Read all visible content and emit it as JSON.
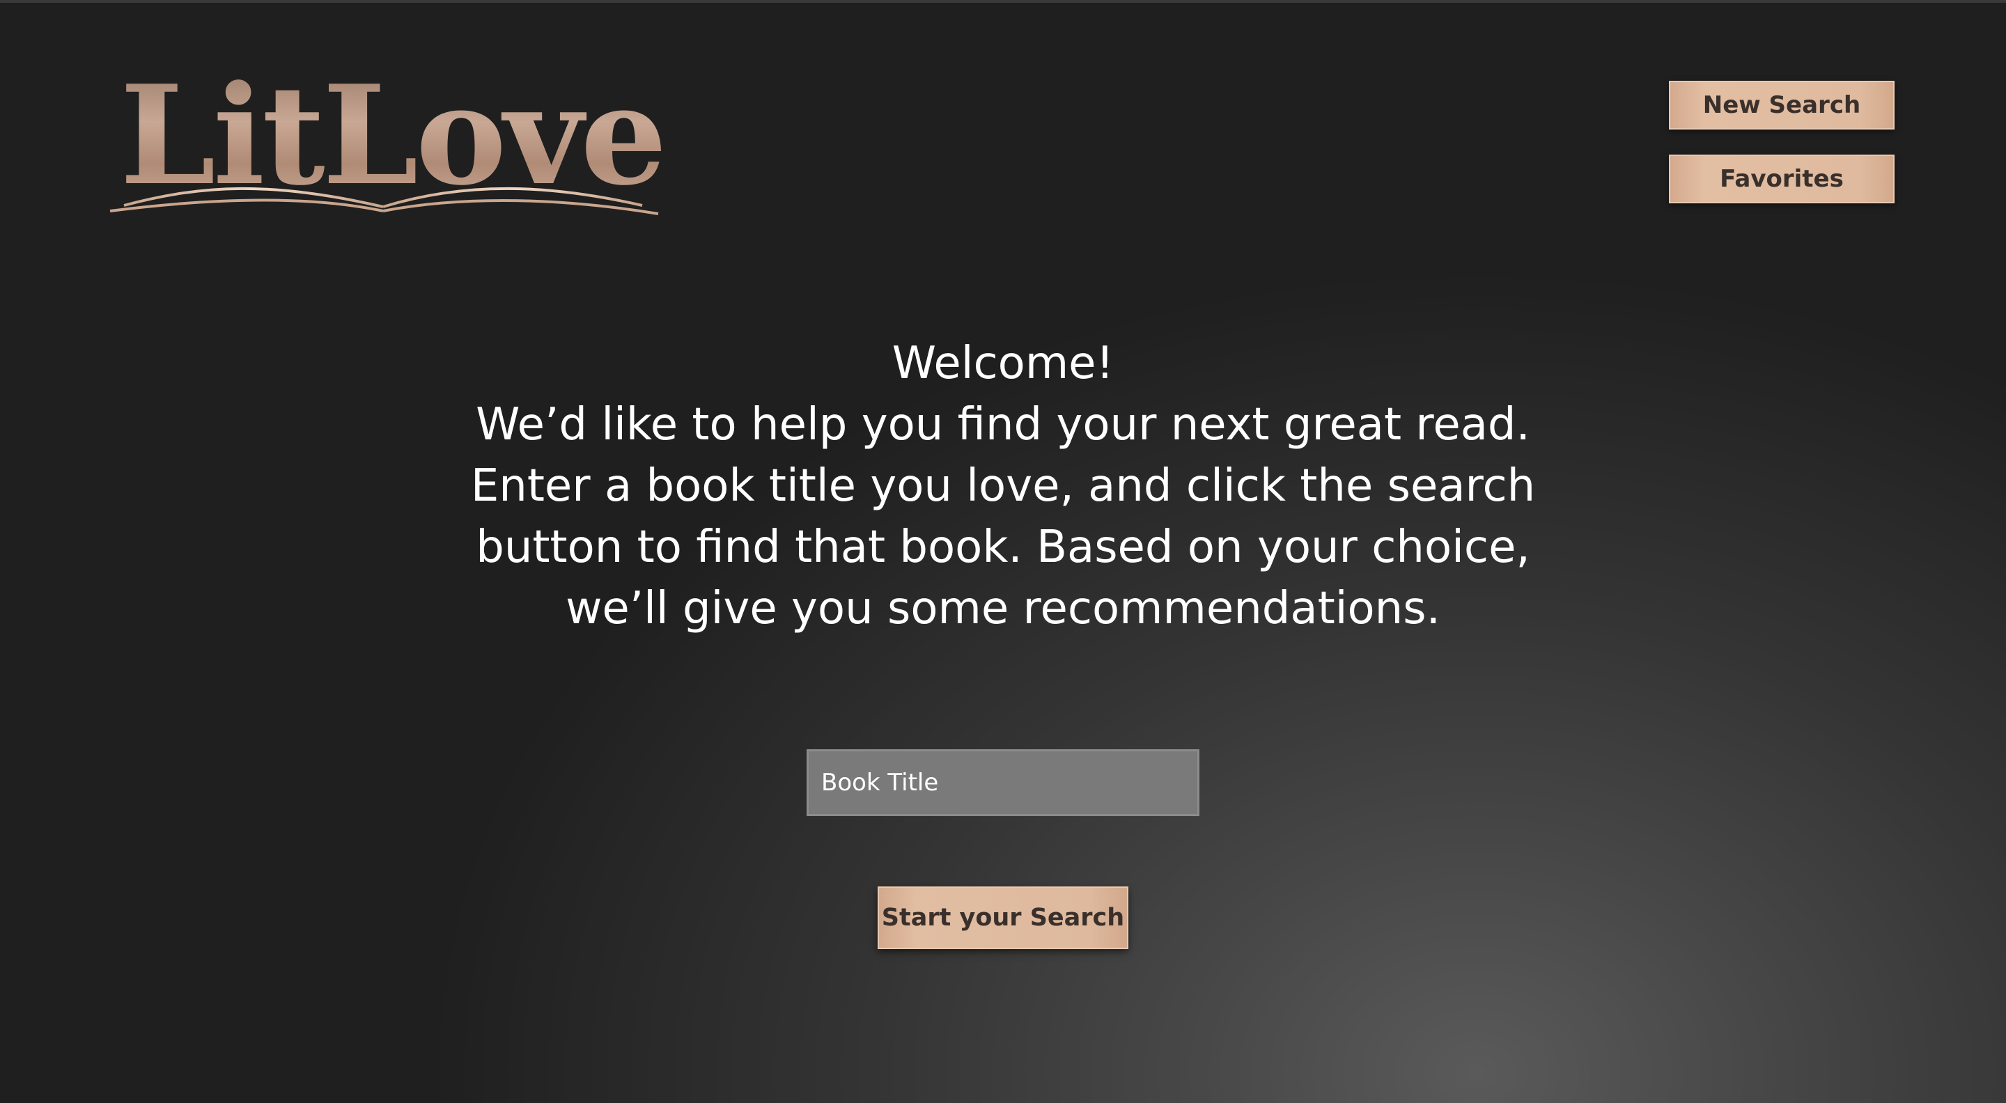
{
  "brand": {
    "logo_text": "LitLove",
    "logo_color": "#b8927c"
  },
  "nav": {
    "new_search_label": "New Search",
    "favorites_label": "Favorites"
  },
  "welcome": {
    "heading": "Welcome!",
    "lines": [
      "We’d like to help you find your next great read.",
      "Enter a book title you love, and click the search",
      "button to find that book. Based on your choice,",
      "we’ll give you some recommendations."
    ]
  },
  "search": {
    "placeholder": "Book Title",
    "value": "",
    "submit_label": "Start your Search"
  },
  "colors": {
    "background": "#1f1f1f",
    "button_fill": "#dfba9e",
    "button_text": "#3a302b",
    "input_fill": "#7a7a7a",
    "text": "#ffffff"
  }
}
